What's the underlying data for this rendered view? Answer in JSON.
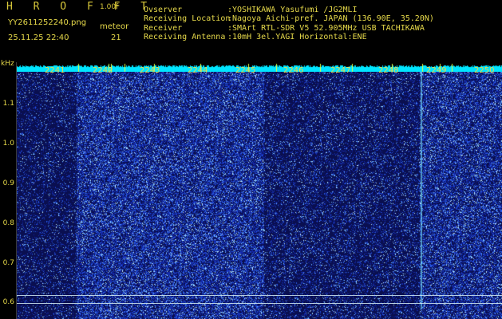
{
  "header": {
    "app_title": "H R O F F T",
    "app_version": "1.00f",
    "file_name": "YY2611252240.png",
    "meteor_label": "meteor",
    "datetime": "25.11.25 22:40",
    "meteor_count": "21"
  },
  "station_info": [
    {
      "label": "Ovserver",
      "value": ":YOSHIKAWA Yasufumi /JG2MLI"
    },
    {
      "label": "Receiving Location",
      "value": ":Nagoya Aichi-pref. JAPAN (136.90E, 35.20N)"
    },
    {
      "label": "Receiver",
      "value": ":SMArt RTL-SDR V5 52.905MHz USB TACHIKAWA"
    },
    {
      "label": "Receiving Antenna",
      "value": ":10mH 3el.YAGI Horizontal:ENE"
    }
  ],
  "axis": {
    "unit": "kHz",
    "y_ticks": [
      "1.1",
      "1.0",
      "0.9",
      "0.8",
      "0.7",
      "0.6"
    ],
    "x_ticks": [
      "2241",
      "2242",
      "2243",
      "2244",
      "2245",
      "2246",
      "2247",
      "2248",
      "2249",
      "2250"
    ]
  },
  "colors": {
    "text": "#e6d94a",
    "waterfall_bg": "#0a0f50",
    "spectrum": "#00e5ff"
  }
}
